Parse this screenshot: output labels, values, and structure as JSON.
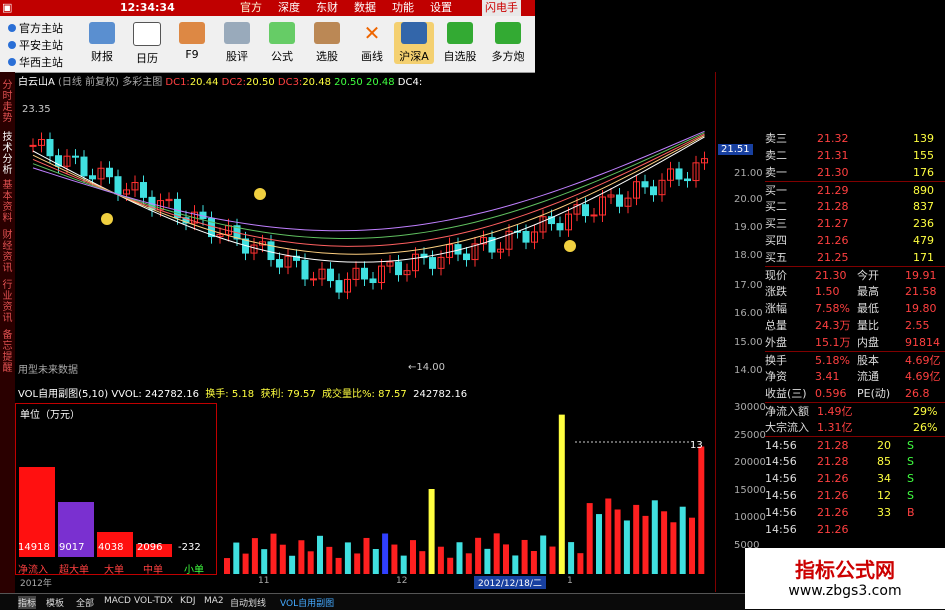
{
  "titlebar": {
    "time": "12:34:34",
    "tabs": [
      "官方",
      "深度",
      "东财",
      "数据",
      "功能",
      "设置"
    ],
    "flash_btn": "闪电手"
  },
  "sites": [
    "官方主站",
    "平安主站",
    "华西主站"
  ],
  "tools": [
    "财报",
    "日历",
    "F9",
    "股评",
    "公式",
    "选股",
    "画线",
    "沪深A",
    "自选股",
    "多方炮"
  ],
  "left_tabs": [
    "分时走势",
    "技术分析",
    "基本资料",
    "财经资讯",
    "行业资讯",
    "备忘提醒"
  ],
  "chart": {
    "header": {
      "stock": "白云山A",
      "mode": "(日线 前复权)",
      "main": "多彩主图",
      "dc": [
        {
          "k": "DC1:",
          "v": "20.44"
        },
        {
          "k": "DC2:",
          "v": "20.50"
        },
        {
          "k": "DC3:",
          "v": "20.48"
        },
        {
          "k": "",
          "v": "20.50"
        },
        {
          "k": "",
          "v": "20.48"
        },
        {
          "k": "DC4:",
          "v": ""
        }
      ]
    },
    "high_label": "23.35",
    "low_label": "14.00",
    "current": "21.51",
    "future_text": "用型未来数据",
    "y_ticks": [
      "21.00",
      "20.00",
      "19.00",
      "18.00",
      "17.00",
      "16.00",
      "15.00",
      "14.00"
    ]
  },
  "chart_data": {
    "type": "bar",
    "title": "VOL自用副图(5,10)",
    "ylim": [
      0,
      32000
    ],
    "y_ticks": [
      "30000",
      "25000",
      "20000",
      "15000",
      "10000",
      "5000"
    ]
  },
  "vol": {
    "title": "VOL自用副图(5,10)",
    "vvol": "VVOL: 242782.16",
    "turnover": "换手: 5.18",
    "profit": "获利: 79.57",
    "ratio": "成交量比%: 87.57",
    "val": "242782.16",
    "marker": "13",
    "unit": "单位（万元）",
    "bars": [
      {
        "v": "14918",
        "lbl": "净流入"
      },
      {
        "v": "9017",
        "lbl": "超大单"
      },
      {
        "v": "4038",
        "lbl": "大单"
      },
      {
        "v": "2096",
        "lbl": "中单"
      },
      {
        "v": "-232",
        "lbl": "小单"
      }
    ]
  },
  "quote": [
    {
      "k": "卖三",
      "v": "21.32",
      "q": "139"
    },
    {
      "k": "卖二",
      "v": "21.31",
      "q": "155"
    },
    {
      "k": "卖一",
      "v": "21.30",
      "q": "176"
    },
    {
      "k": "买一",
      "v": "21.29",
      "q": "890"
    },
    {
      "k": "买二",
      "v": "21.28",
      "q": "837"
    },
    {
      "k": "买三",
      "v": "21.27",
      "q": "236"
    },
    {
      "k": "买四",
      "v": "21.26",
      "q": "479"
    },
    {
      "k": "买五",
      "v": "21.25",
      "q": "171"
    },
    {
      "k": "现价",
      "v": "21.30",
      "k2": "今开",
      "v2": "19.91"
    },
    {
      "k": "涨跌",
      "v": "1.50",
      "k2": "最高",
      "v2": "21.58"
    },
    {
      "k": "涨幅",
      "v": "7.58%",
      "k2": "最低",
      "v2": "19.80"
    },
    {
      "k": "总量",
      "v": "24.3万",
      "k2": "量比",
      "v2": "2.55"
    },
    {
      "k": "外盘",
      "v": "15.1万",
      "k2": "内盘",
      "v2": "91814"
    },
    {
      "k": "换手",
      "v": "5.18%",
      "k2": "股本",
      "v2": "4.69亿"
    },
    {
      "k": "净资",
      "v": "3.41",
      "k2": "流通",
      "v2": "4.69亿"
    },
    {
      "k": "收益(三)",
      "v": "0.596",
      "k2": "PE(动)",
      "v2": "26.8"
    },
    {
      "k": "净流入额",
      "v": "1.49亿",
      "q": "29%"
    },
    {
      "k": "大宗流入",
      "v": "1.31亿",
      "q": "26%"
    },
    {
      "t": "14:56",
      "p": "21.28",
      "n": "20",
      "s": "S"
    },
    {
      "t": "14:56",
      "p": "21.28",
      "n": "85",
      "s": "S"
    },
    {
      "t": "14:56",
      "p": "21.26",
      "n": "34",
      "s": "S"
    },
    {
      "t": "14:56",
      "p": "21.26",
      "n": "12",
      "s": "S"
    },
    {
      "t": "14:56",
      "p": "21.26",
      "n": "33",
      "s": "B"
    },
    {
      "t": "14:56",
      "p": "21.26",
      "n": "",
      "s": ""
    }
  ],
  "xaxis": {
    "a": "2012年",
    "b": "11",
    "c": "12",
    "date": "2012/12/18/二",
    "d": "1"
  },
  "bottom_tabs": [
    "指标",
    "模板",
    "全部",
    "MACD",
    "VOL-TDX",
    "KDJ",
    "MA2",
    "自动划线",
    "VOL自用副图"
  ],
  "watermark": {
    "line1": "指标公式网",
    "line2": "www.zbgs3.com"
  },
  "colors": {
    "up": "#ff3030",
    "down": "#40e0e0",
    "ma": "#ffffff"
  }
}
